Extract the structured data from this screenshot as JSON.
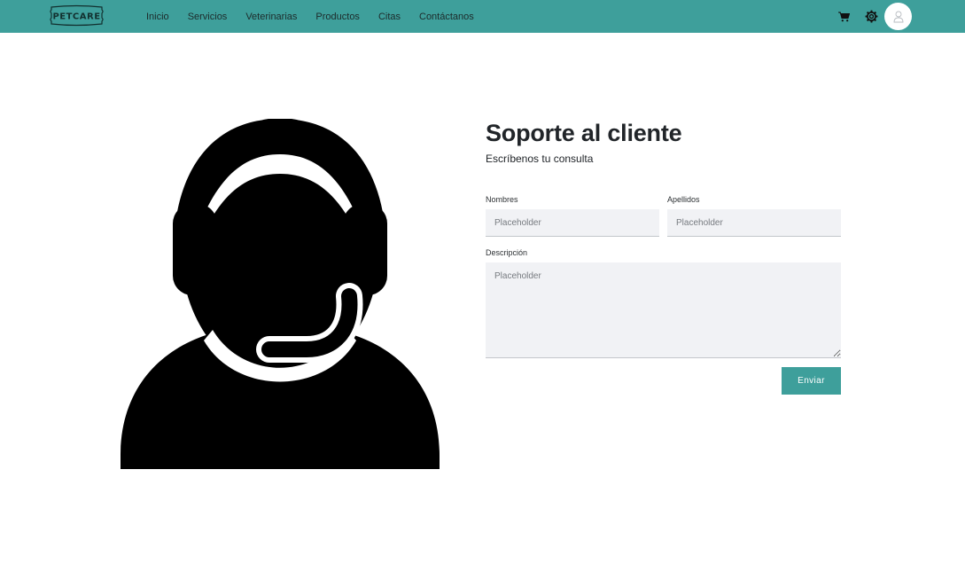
{
  "brand": {
    "logo_text": "PETCARE",
    "accent_color": "#3e9f9b"
  },
  "nav": {
    "links": [
      {
        "label": "Inicio"
      },
      {
        "label": "Servicios"
      },
      {
        "label": "Veterinarias"
      },
      {
        "label": "Productos"
      },
      {
        "label": "Citas"
      },
      {
        "label": "Contáctanos"
      }
    ],
    "icons": [
      "cart-icon",
      "gear-icon",
      "user-icon"
    ]
  },
  "support": {
    "illustration": "customer-support-headset-icon",
    "title": "Soporte al cliente",
    "subtitle": "Escríbenos tu consulta",
    "fields": {
      "first_name": {
        "label": "Nombres",
        "placeholder": "Placeholder",
        "value": ""
      },
      "last_name": {
        "label": "Apellidos",
        "placeholder": "Placeholder",
        "value": ""
      },
      "description": {
        "label": "Descripción",
        "placeholder": "Placeholder",
        "value": ""
      }
    },
    "submit_label": "Enviar"
  }
}
